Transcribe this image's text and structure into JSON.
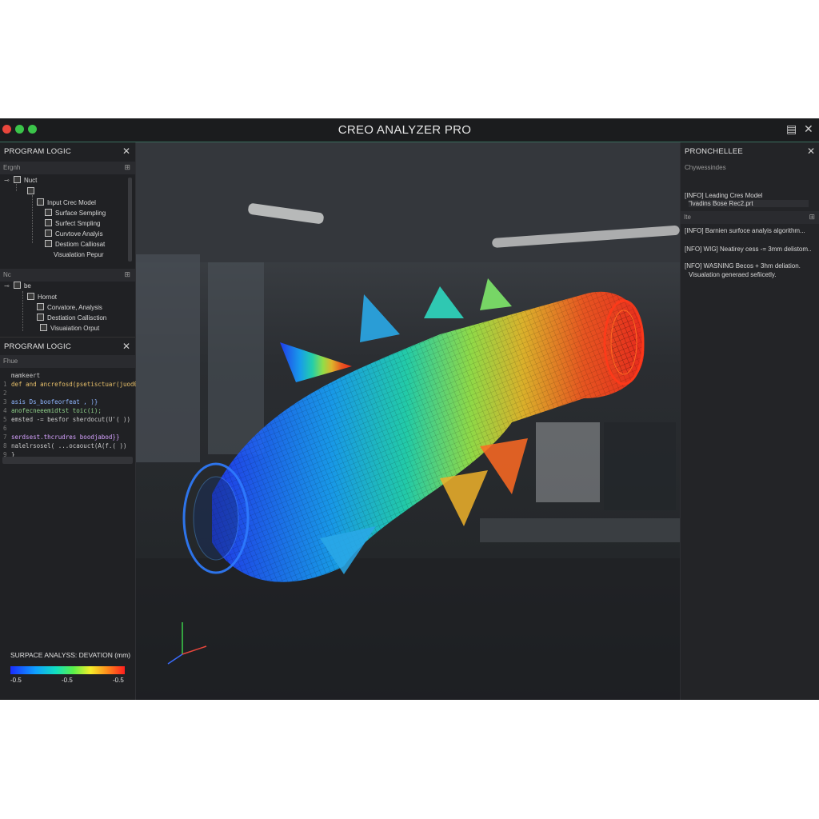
{
  "window": {
    "title": "CREO ANALYZER PRO",
    "controls": [
      "close",
      "minimize",
      "maximize"
    ]
  },
  "tree_panel": {
    "title": "PROGRAM LOGIC",
    "toolbar_label": "Ergnh",
    "root": "Nuct",
    "items": [
      "Input Crec Model",
      "Surface Sempling",
      "Surfect Smpling",
      "Curvtove Analyis",
      "Destiom Calliosat",
      "Visualation Pepur"
    ]
  },
  "tree_panel_2": {
    "toolbar_label": "Nc",
    "root": "be",
    "items": [
      "Hornot",
      "Corvatore, Analysis",
      "Destiation Callisction",
      "Visuaiation Orput"
    ]
  },
  "code_panel": {
    "title": "PROGRAM LOGIC",
    "toolbar_label": "Fhue",
    "lines": [
      {
        "n": "",
        "text": "mamkeert",
        "color": "#c8c8c8"
      },
      {
        "n": "1",
        "text": "def and ancrefosd(psetisctuar(juod0):",
        "color": "#e8c06a"
      },
      {
        "n": "2",
        "text": "",
        "color": "#c8c8c8"
      },
      {
        "n": "3",
        "text": "asis Ds_boofeorfeat , )}",
        "color": "#8fb6ff"
      },
      {
        "n": "4",
        "text": "anofecneeemidtst toic(i);",
        "color": "#8fd08a"
      },
      {
        "n": "5",
        "text": "emsted -= besfor sherdocut(U'( ))",
        "color": "#c8c8c8"
      },
      {
        "n": "6",
        "text": "",
        "color": "#c8c8c8"
      },
      {
        "n": "7",
        "text": "serdsest.thcrudres boodjabod}}",
        "color": "#d6a2ff"
      },
      {
        "n": "8",
        "text": "nalelrsosel( ...ocaouct(A(f.( ))",
        "color": "#c8c8c8"
      },
      {
        "n": "9",
        "text": "}",
        "color": "#c8c8c8"
      }
    ]
  },
  "legend": {
    "title": "SURPACE ANALYSS: DEVATION (mm)",
    "ticks": [
      "-0.5",
      "-0.5",
      "-0.5"
    ]
  },
  "output_panel": {
    "title": "PRONCHELLEE",
    "subtitle": "Chywessindes",
    "tab_label": "Ite",
    "logs": [
      "[INFO] Leading Cres Model",
      "\"lvadins Bose Rec2.prt",
      "[INFO] Barnien surfoce analyis algorithm...",
      "[NFO] WIG] Neatirey cess -= 3mm delistom..",
      "[NFO] WASNING Becos + 3hm deliation.",
      "Visualation generaed sefiicetly."
    ]
  },
  "colors": {
    "background": "#1d1e20",
    "accent": "#3a6e5e",
    "gradient": [
      "#1a2cff",
      "#0fa0ff",
      "#12e0c0",
      "#5af04a",
      "#f5ee2a",
      "#ff8a1c",
      "#ff1e1e"
    ]
  }
}
